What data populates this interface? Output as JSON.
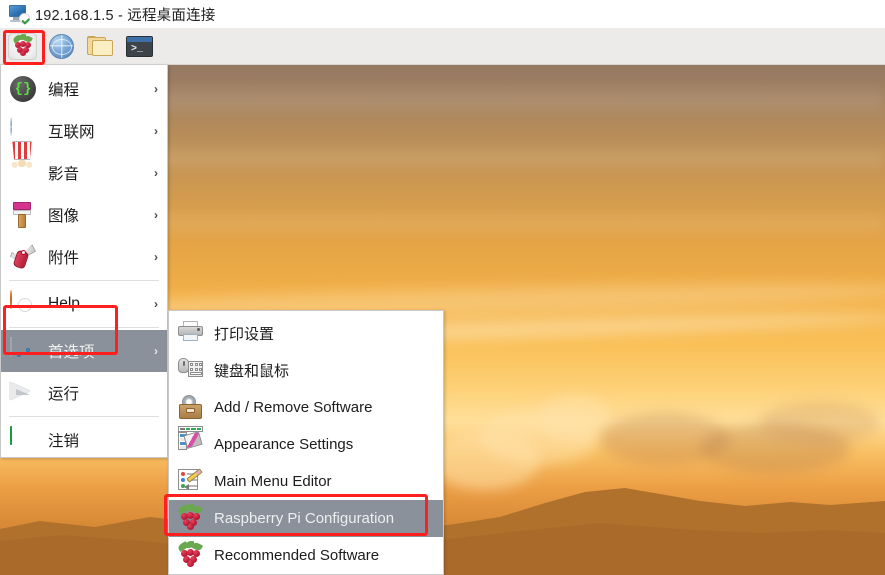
{
  "window": {
    "title": "192.168.1.5 - 远程桌面连接",
    "icon": "remote-desktop-monitor-icon"
  },
  "taskbar": {
    "buttons": [
      {
        "name": "raspberry-menu-button",
        "icon": "raspberry-pi-icon",
        "label": ""
      },
      {
        "name": "web-browser-button",
        "icon": "globe-icon",
        "label": ""
      },
      {
        "name": "file-manager-button",
        "icon": "folder-icon",
        "label": ""
      },
      {
        "name": "terminal-button",
        "icon": "terminal-icon",
        "label": ""
      }
    ]
  },
  "root_menu": {
    "items": [
      {
        "label": "编程",
        "icon": "code-braces-icon",
        "arrow": "›",
        "selected": false,
        "separator_after": false
      },
      {
        "label": "互联网",
        "icon": "globe-icon",
        "arrow": "›",
        "selected": false,
        "separator_after": false
      },
      {
        "label": "影音",
        "icon": "popcorn-media-icon",
        "arrow": "›",
        "selected": false,
        "separator_after": false
      },
      {
        "label": "图像",
        "icon": "paintbrush-icon",
        "arrow": "›",
        "selected": false,
        "separator_after": false
      },
      {
        "label": "附件",
        "icon": "swiss-army-knife-icon",
        "arrow": "›",
        "selected": false,
        "separator_after": true
      },
      {
        "label": "Help",
        "icon": "life-ring-icon",
        "arrow": "›",
        "selected": false,
        "separator_after": true
      },
      {
        "label": "首选项",
        "icon": "preferences-window-icon",
        "arrow": "›",
        "selected": true,
        "separator_after": false
      },
      {
        "label": "运行",
        "icon": "paper-plane-icon",
        "arrow": "",
        "selected": false,
        "separator_after": true
      },
      {
        "label": "注销",
        "icon": "logout-exit-icon",
        "arrow": "",
        "selected": false,
        "separator_after": false
      }
    ]
  },
  "submenu": {
    "parent": "首选项",
    "items": [
      {
        "label": "打印设置",
        "icon": "printer-icon",
        "selected": false
      },
      {
        "label": "键盘和鼠标",
        "icon": "keyboard-mouse-icon",
        "selected": false
      },
      {
        "label": "Add / Remove Software",
        "icon": "software-briefcase-icon",
        "selected": false
      },
      {
        "label": "Appearance Settings",
        "icon": "color-swatches-icon",
        "selected": false
      },
      {
        "label": "Main Menu Editor",
        "icon": "menu-editor-pencil-icon",
        "selected": false
      },
      {
        "label": "Raspberry Pi Configuration",
        "icon": "raspberry-pi-icon",
        "selected": true
      },
      {
        "label": "Recommended Software",
        "icon": "raspberry-pi-icon",
        "selected": false
      }
    ]
  },
  "annotations": [
    {
      "name": "annotation-raspberry-menu-button",
      "color": "#ff1f1f"
    },
    {
      "name": "annotation-preferences-menu-item",
      "color": "#ff1f1f"
    },
    {
      "name": "annotation-raspberry-pi-configuration",
      "color": "#ff1f1f"
    }
  ],
  "desktop": {
    "wallpaper": "sunset-clouds-mountains",
    "colors": {
      "sky_top": "#947963",
      "sky_mid": "#f2af47",
      "sky_glow": "#ffe09a",
      "ridge": "#b4702a"
    }
  },
  "theme": {
    "titlebar_bg": "#ffffff",
    "taskbar_bg": "#ECEBE9",
    "menu_bg": "#ffffff",
    "menu_highlight": "#8b919a",
    "menu_text": "#1c1c1c",
    "menu_highlight_text": "#eceff1",
    "accent_red": "#ff1f1f"
  }
}
